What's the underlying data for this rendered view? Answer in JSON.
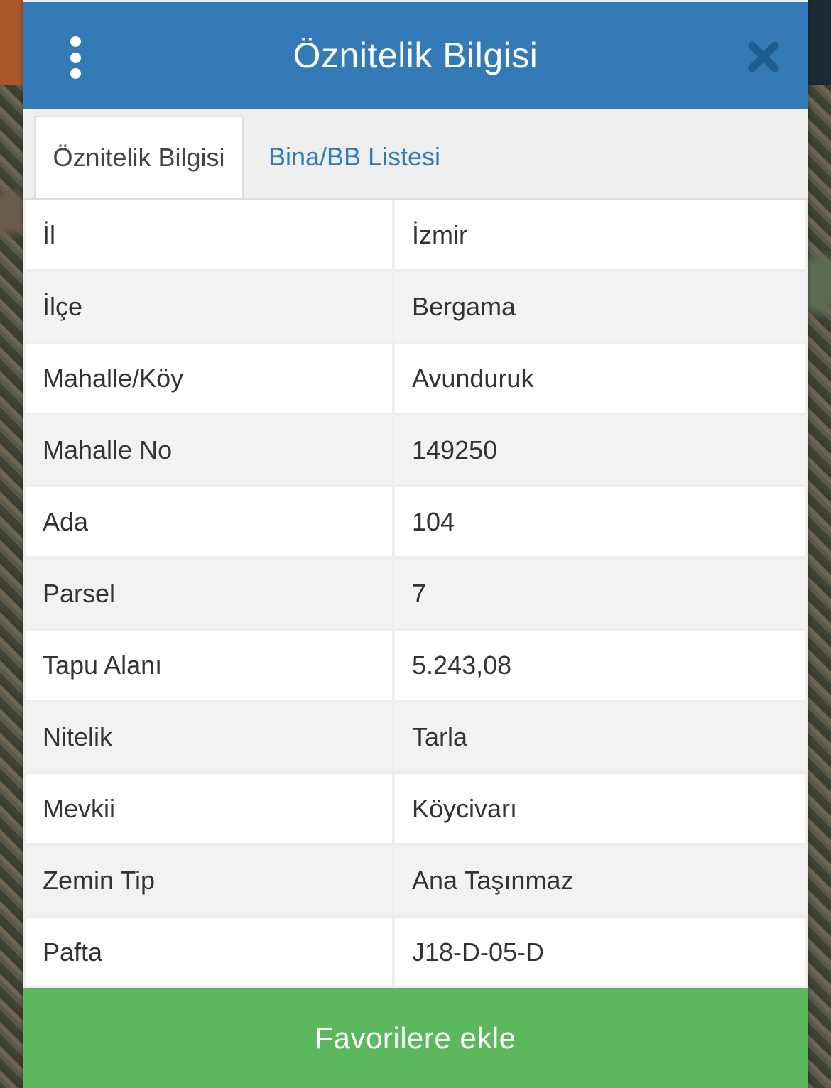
{
  "header": {
    "title": "Öznitelik Bilgisi",
    "menu_icon": "vertical-ellipsis-icon",
    "close_icon": "close-icon"
  },
  "tabs": [
    {
      "label": "Öznitelik Bilgisi",
      "active": true
    },
    {
      "label": "Bina/BB Listesi",
      "active": false
    }
  ],
  "attributes": [
    {
      "key": "İl",
      "value": "İzmir"
    },
    {
      "key": "İlçe",
      "value": "Bergama"
    },
    {
      "key": "Mahalle/Köy",
      "value": "Avunduruk"
    },
    {
      "key": "Mahalle No",
      "value": "149250"
    },
    {
      "key": "Ada",
      "value": "104"
    },
    {
      "key": "Parsel",
      "value": "7"
    },
    {
      "key": "Tapu Alanı",
      "value": "5.243,08"
    },
    {
      "key": "Nitelik",
      "value": "Tarla"
    },
    {
      "key": "Mevkii",
      "value": "Köycivarı"
    },
    {
      "key": "Zemin Tip",
      "value": "Ana Taşınmaz"
    },
    {
      "key": "Pafta",
      "value": "J18-D-05-D"
    }
  ],
  "footer": {
    "favorite_label": "Favorilere ekle"
  },
  "colors": {
    "header": "#337ab7",
    "tab_link": "#337ab7",
    "favorite_button": "#5cb85c",
    "close_icon": "#1f5d8f"
  }
}
